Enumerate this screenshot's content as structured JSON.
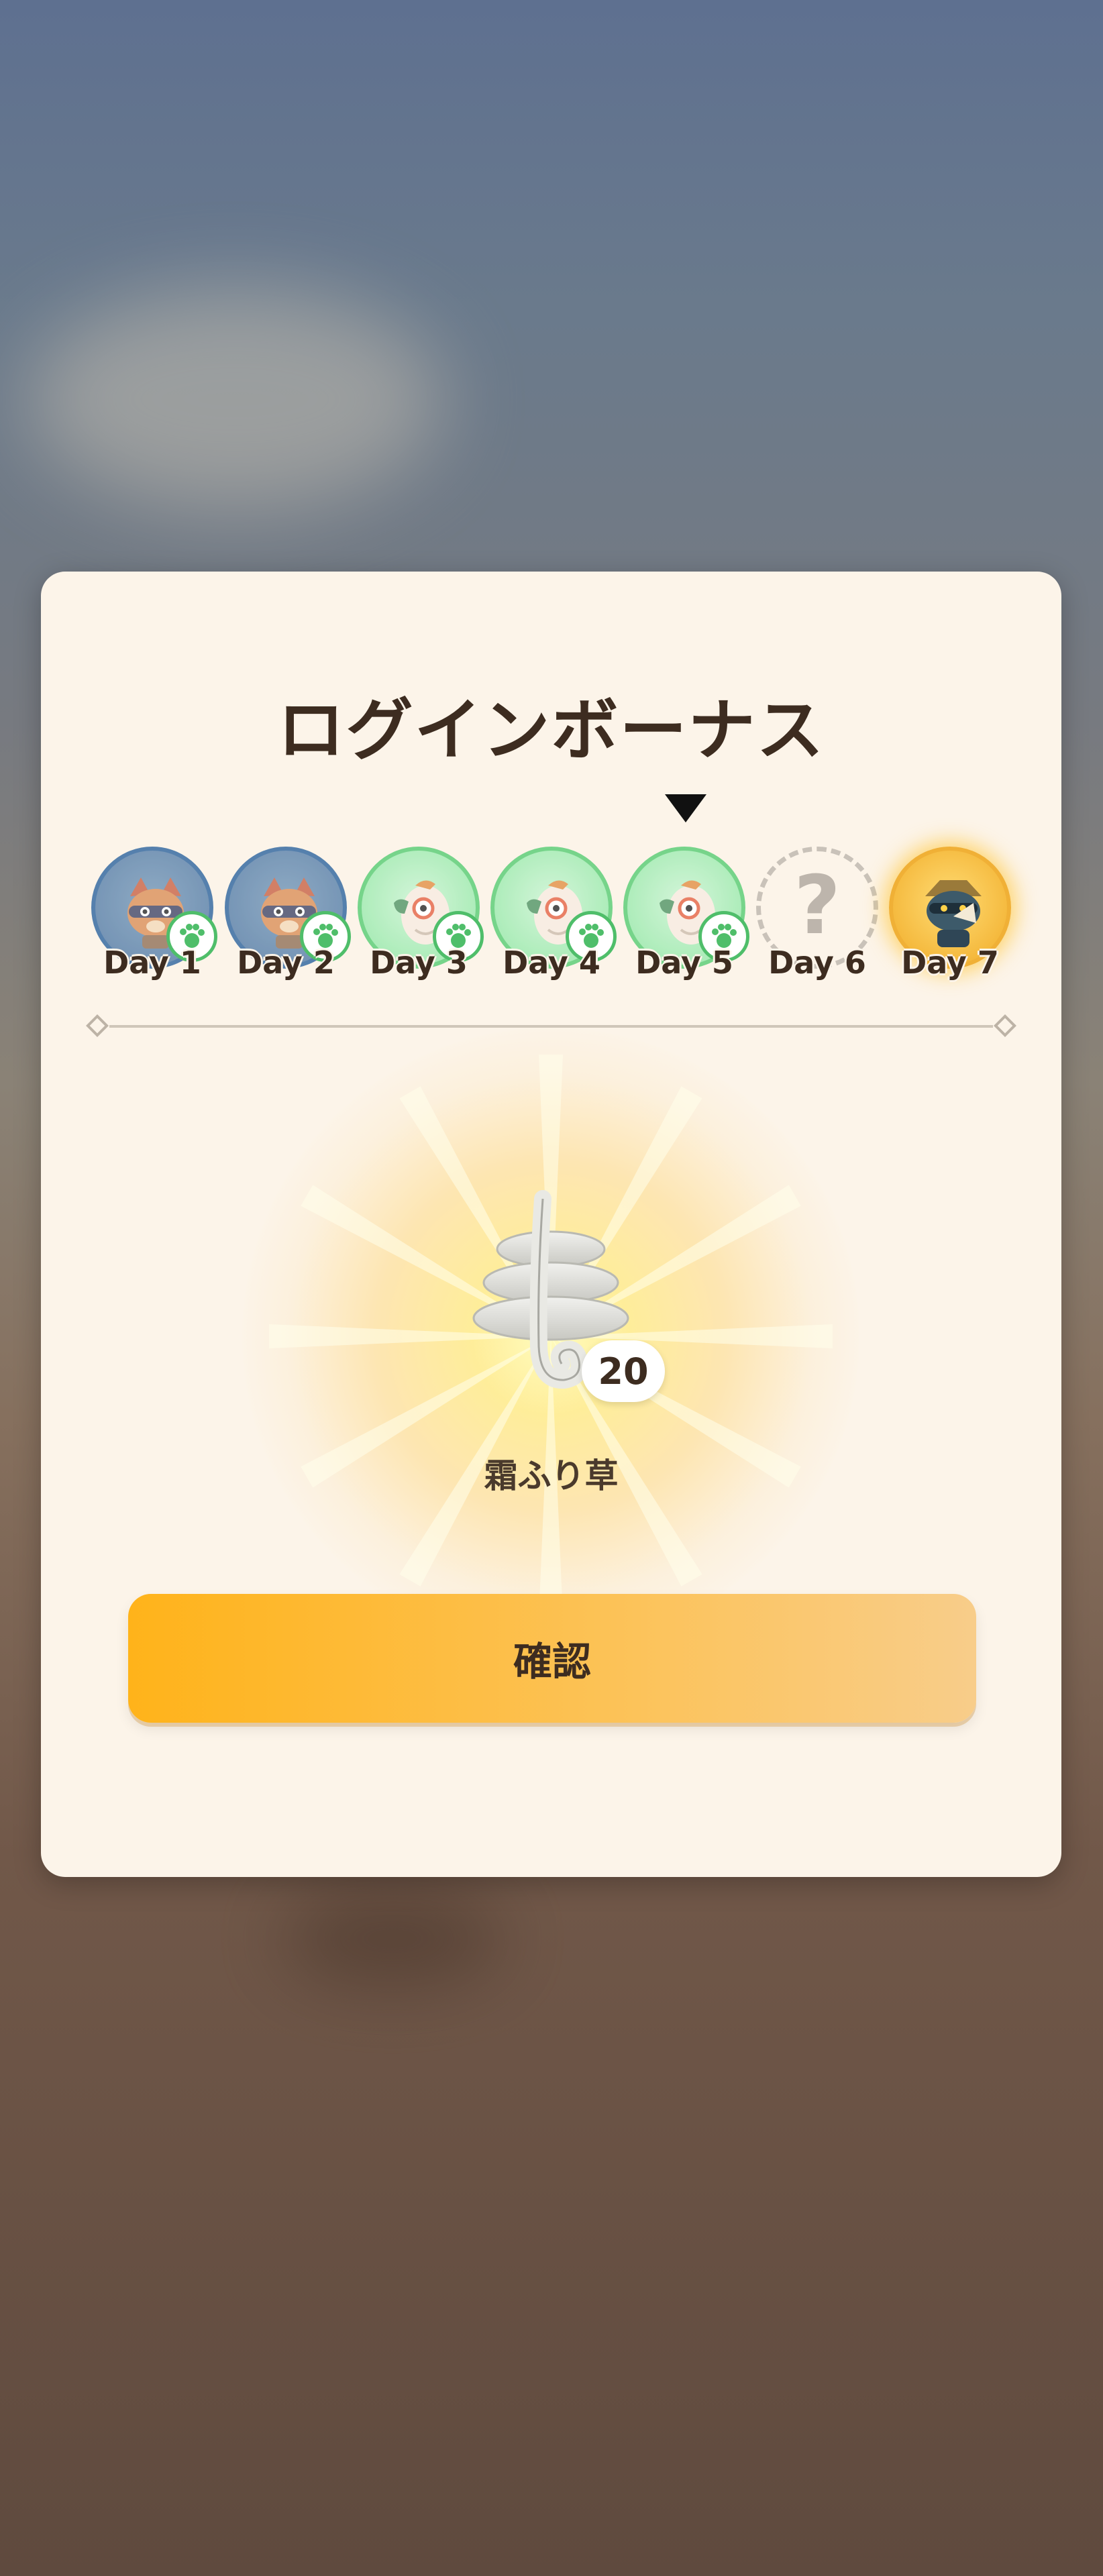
{
  "popup": {
    "title": "ログインボーナス",
    "days": [
      {
        "label": "Day 1",
        "state": "claimed",
        "icon": "raccoon-cat-icon",
        "badge": "paw-icon",
        "color": "#4e76a0"
      },
      {
        "label": "Day 2",
        "state": "claimed",
        "icon": "raccoon-cat-icon",
        "badge": "paw-icon",
        "color": "#4e76a0"
      },
      {
        "label": "Day 3",
        "state": "claimed",
        "icon": "bird-icon",
        "badge": "paw-icon",
        "color": "#8ee5a0"
      },
      {
        "label": "Day 4",
        "state": "claimed",
        "icon": "bird-icon",
        "badge": "paw-icon",
        "color": "#8ee5a0"
      },
      {
        "label": "Day 5",
        "state": "current",
        "icon": "bird-icon",
        "badge": "paw-icon",
        "color": "#8ee5a0"
      },
      {
        "label": "Day 6",
        "state": "locked",
        "icon": "question-mark-icon",
        "mark": "?"
      },
      {
        "label": "Day 7",
        "state": "special",
        "icon": "masked-cat-icon",
        "color": "#f4b73a"
      }
    ],
    "reward": {
      "name": "霜ふり草",
      "quantity": "20",
      "icon": "frost-grass-icon"
    },
    "confirm_label": "確認"
  },
  "colors": {
    "panel": "#fcf4e9",
    "text": "#3d2c20",
    "button_start": "#ffb31a",
    "button_end": "#f8cd8a"
  }
}
